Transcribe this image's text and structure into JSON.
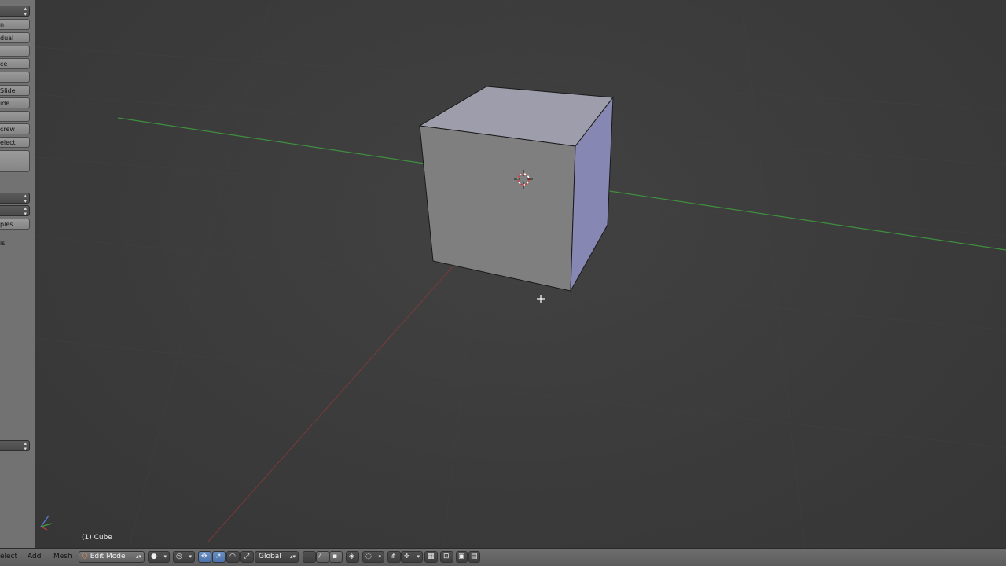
{
  "toolshelf": {
    "items": [
      {
        "label": "n",
        "kind": "button"
      },
      {
        "label": "dual",
        "kind": "button"
      },
      {
        "label": "",
        "kind": "button"
      },
      {
        "label": "ce",
        "kind": "button"
      },
      {
        "label": "",
        "kind": "button"
      },
      {
        "label": "Slide",
        "kind": "button"
      },
      {
        "label": "ide",
        "kind": "button"
      },
      {
        "label": "",
        "kind": "button"
      },
      {
        "label": "crew",
        "kind": "button"
      },
      {
        "label": "elect",
        "kind": "button"
      },
      {
        "label": "",
        "kind": "button"
      }
    ],
    "dropdown_rows": 2,
    "after_dropdown": {
      "button_label": "ples",
      "text_label": "ls"
    }
  },
  "viewport": {
    "object_label": "(1) Cube",
    "colors": {
      "x_axis": "#b04040",
      "y_axis": "#3f8f3f",
      "cube_top": "#9a9aa8",
      "cube_front": "#7e7e7e",
      "cube_side": "#8a8ab8"
    }
  },
  "header": {
    "menus": [
      "elect",
      "Add",
      "Mesh"
    ],
    "mode_label": "Edit Mode",
    "orientation_label": "Global",
    "icons": [
      "mode-icon",
      "viewport-shading-icon",
      "pivot-point-icon",
      "manipulator-icon",
      "translate-icon",
      "rotate-icon",
      "scale-icon",
      "vertex-select-icon",
      "edge-select-icon",
      "face-select-icon",
      "limit-selection-icon",
      "proportional-edit-icon",
      "snap-icon",
      "snap-target-icon",
      "render-icon"
    ]
  }
}
